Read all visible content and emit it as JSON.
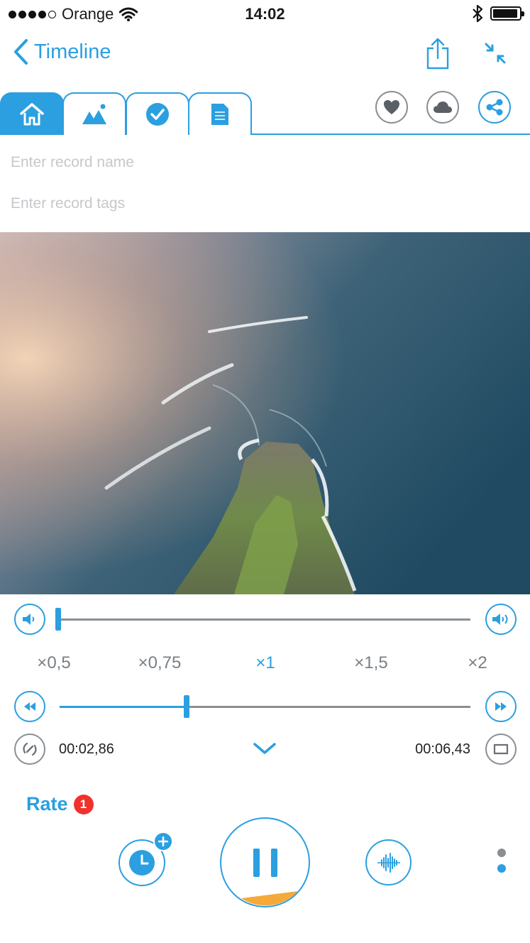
{
  "status_bar": {
    "carrier": "Orange",
    "time": "14:02",
    "icons": [
      "wifi-icon",
      "bluetooth-icon",
      "battery-icon"
    ]
  },
  "nav": {
    "back_label": "Timeline",
    "icons": [
      "share-upload-icon",
      "collapse-icon"
    ]
  },
  "tabs": {
    "items": [
      {
        "icon": "home-icon",
        "active": true
      },
      {
        "icon": "image-icon",
        "active": false
      },
      {
        "icon": "check-icon",
        "active": false
      },
      {
        "icon": "document-icon",
        "active": false
      }
    ],
    "actions": [
      "heart-icon",
      "cloud-icon",
      "share-icon"
    ]
  },
  "form": {
    "name_placeholder": "Enter record name",
    "tags_placeholder": "Enter record tags",
    "name_value": "",
    "tags_value": ""
  },
  "player": {
    "volume_level": 0.0,
    "speed_options": [
      "×0,5",
      "×0,75",
      "×1",
      "×1,5",
      "×2"
    ],
    "speed_selected": "×1",
    "progress_fraction": 0.31,
    "current_time": "00:02,86",
    "total_time": "00:06,43",
    "rate_label": "Rate",
    "rate_badge": "1"
  },
  "colors": {
    "accent": "#2b9fe0",
    "muted": "#8a8f94",
    "badge": "#f0322c",
    "progress_wedge": "#f5a93a"
  }
}
